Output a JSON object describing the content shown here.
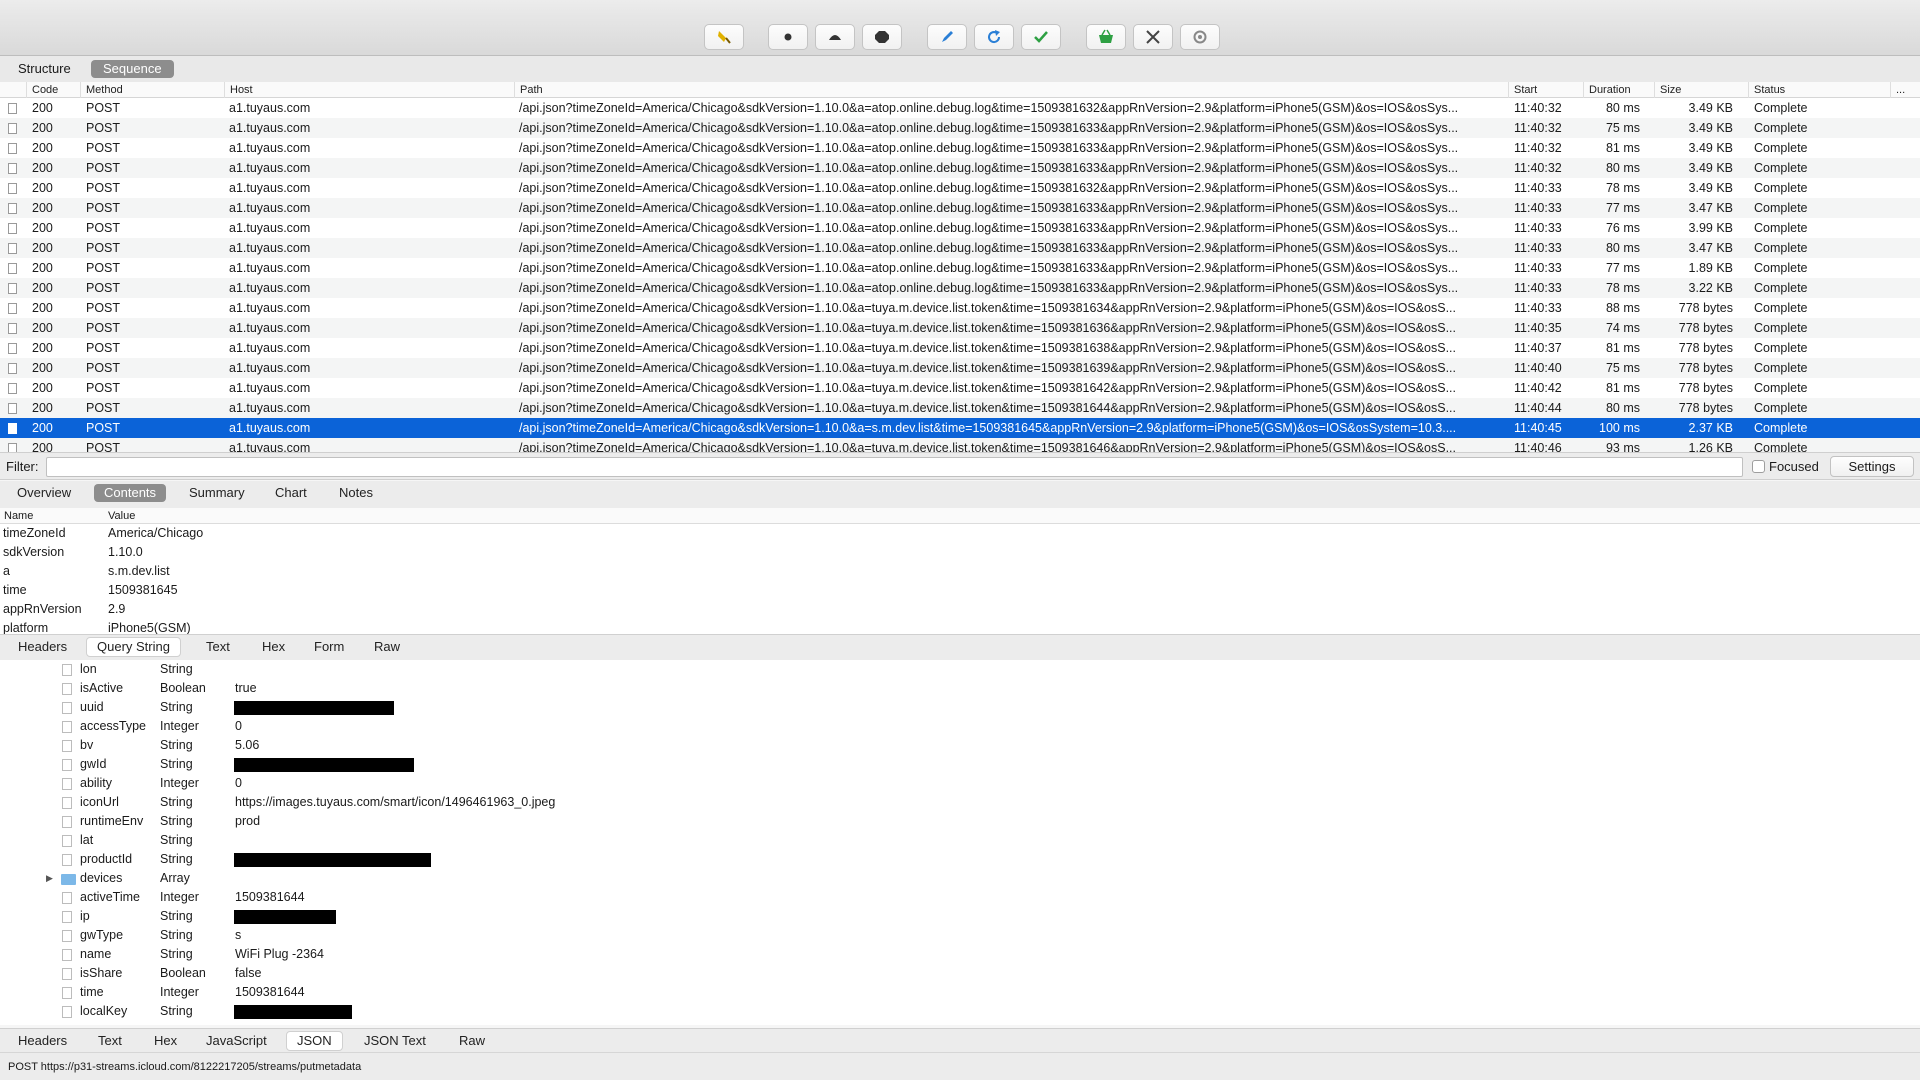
{
  "toolbar": {
    "buttons": [
      "broom-icon",
      "record-icon",
      "turtle-icon",
      "breakpoint-icon",
      "pen-icon",
      "refresh-icon",
      "check-icon",
      "basket-icon",
      "tools-icon",
      "settings-gear-icon"
    ],
    "colors": {
      "yellow": "#e0b100",
      "blue": "#2a7fd6",
      "green": "#2ea043",
      "gray": "#555555"
    }
  },
  "view_tabs": {
    "structure": "Structure",
    "sequence": "Sequence"
  },
  "sequence_table": {
    "columns": {
      "code": "Code",
      "method": "Method",
      "host": "Host",
      "path": "Path",
      "start": "Start",
      "duration": "Duration",
      "size": "Size",
      "status": "Status",
      "more": "..."
    },
    "rows": [
      {
        "code": "200",
        "method": "POST",
        "host": "a1.tuyaus.com",
        "path": "/api.json?timeZoneId=America/Chicago&sdkVersion=1.10.0&a=atop.online.debug.log&time=1509381632&appRnVersion=2.9&platform=iPhone5(GSM)&os=IOS&osSys...",
        "start": "11:40:32",
        "duration": "80 ms",
        "size": "3.49 KB",
        "status": "Complete"
      },
      {
        "code": "200",
        "method": "POST",
        "host": "a1.tuyaus.com",
        "path": "/api.json?timeZoneId=America/Chicago&sdkVersion=1.10.0&a=atop.online.debug.log&time=1509381633&appRnVersion=2.9&platform=iPhone5(GSM)&os=IOS&osSys...",
        "start": "11:40:32",
        "duration": "75 ms",
        "size": "3.49 KB",
        "status": "Complete"
      },
      {
        "code": "200",
        "method": "POST",
        "host": "a1.tuyaus.com",
        "path": "/api.json?timeZoneId=America/Chicago&sdkVersion=1.10.0&a=atop.online.debug.log&time=1509381633&appRnVersion=2.9&platform=iPhone5(GSM)&os=IOS&osSys...",
        "start": "11:40:32",
        "duration": "81 ms",
        "size": "3.49 KB",
        "status": "Complete"
      },
      {
        "code": "200",
        "method": "POST",
        "host": "a1.tuyaus.com",
        "path": "/api.json?timeZoneId=America/Chicago&sdkVersion=1.10.0&a=atop.online.debug.log&time=1509381633&appRnVersion=2.9&platform=iPhone5(GSM)&os=IOS&osSys...",
        "start": "11:40:32",
        "duration": "80 ms",
        "size": "3.49 KB",
        "status": "Complete"
      },
      {
        "code": "200",
        "method": "POST",
        "host": "a1.tuyaus.com",
        "path": "/api.json?timeZoneId=America/Chicago&sdkVersion=1.10.0&a=atop.online.debug.log&time=1509381632&appRnVersion=2.9&platform=iPhone5(GSM)&os=IOS&osSys...",
        "start": "11:40:33",
        "duration": "78 ms",
        "size": "3.49 KB",
        "status": "Complete"
      },
      {
        "code": "200",
        "method": "POST",
        "host": "a1.tuyaus.com",
        "path": "/api.json?timeZoneId=America/Chicago&sdkVersion=1.10.0&a=atop.online.debug.log&time=1509381633&appRnVersion=2.9&platform=iPhone5(GSM)&os=IOS&osSys...",
        "start": "11:40:33",
        "duration": "77 ms",
        "size": "3.47 KB",
        "status": "Complete"
      },
      {
        "code": "200",
        "method": "POST",
        "host": "a1.tuyaus.com",
        "path": "/api.json?timeZoneId=America/Chicago&sdkVersion=1.10.0&a=atop.online.debug.log&time=1509381633&appRnVersion=2.9&platform=iPhone5(GSM)&os=IOS&osSys...",
        "start": "11:40:33",
        "duration": "76 ms",
        "size": "3.99 KB",
        "status": "Complete"
      },
      {
        "code": "200",
        "method": "POST",
        "host": "a1.tuyaus.com",
        "path": "/api.json?timeZoneId=America/Chicago&sdkVersion=1.10.0&a=atop.online.debug.log&time=1509381633&appRnVersion=2.9&platform=iPhone5(GSM)&os=IOS&osSys...",
        "start": "11:40:33",
        "duration": "80 ms",
        "size": "3.47 KB",
        "status": "Complete"
      },
      {
        "code": "200",
        "method": "POST",
        "host": "a1.tuyaus.com",
        "path": "/api.json?timeZoneId=America/Chicago&sdkVersion=1.10.0&a=atop.online.debug.log&time=1509381633&appRnVersion=2.9&platform=iPhone5(GSM)&os=IOS&osSys...",
        "start": "11:40:33",
        "duration": "77 ms",
        "size": "1.89 KB",
        "status": "Complete"
      },
      {
        "code": "200",
        "method": "POST",
        "host": "a1.tuyaus.com",
        "path": "/api.json?timeZoneId=America/Chicago&sdkVersion=1.10.0&a=atop.online.debug.log&time=1509381633&appRnVersion=2.9&platform=iPhone5(GSM)&os=IOS&osSys...",
        "start": "11:40:33",
        "duration": "78 ms",
        "size": "3.22 KB",
        "status": "Complete"
      },
      {
        "code": "200",
        "method": "POST",
        "host": "a1.tuyaus.com",
        "path": "/api.json?timeZoneId=America/Chicago&sdkVersion=1.10.0&a=tuya.m.device.list.token&time=1509381634&appRnVersion=2.9&platform=iPhone5(GSM)&os=IOS&osS...",
        "start": "11:40:33",
        "duration": "88 ms",
        "size": "778 bytes",
        "status": "Complete"
      },
      {
        "code": "200",
        "method": "POST",
        "host": "a1.tuyaus.com",
        "path": "/api.json?timeZoneId=America/Chicago&sdkVersion=1.10.0&a=tuya.m.device.list.token&time=1509381636&appRnVersion=2.9&platform=iPhone5(GSM)&os=IOS&osS...",
        "start": "11:40:35",
        "duration": "74 ms",
        "size": "778 bytes",
        "status": "Complete"
      },
      {
        "code": "200",
        "method": "POST",
        "host": "a1.tuyaus.com",
        "path": "/api.json?timeZoneId=America/Chicago&sdkVersion=1.10.0&a=tuya.m.device.list.token&time=1509381638&appRnVersion=2.9&platform=iPhone5(GSM)&os=IOS&osS...",
        "start": "11:40:37",
        "duration": "81 ms",
        "size": "778 bytes",
        "status": "Complete"
      },
      {
        "code": "200",
        "method": "POST",
        "host": "a1.tuyaus.com",
        "path": "/api.json?timeZoneId=America/Chicago&sdkVersion=1.10.0&a=tuya.m.device.list.token&time=1509381639&appRnVersion=2.9&platform=iPhone5(GSM)&os=IOS&osS...",
        "start": "11:40:40",
        "duration": "75 ms",
        "size": "778 bytes",
        "status": "Complete"
      },
      {
        "code": "200",
        "method": "POST",
        "host": "a1.tuyaus.com",
        "path": "/api.json?timeZoneId=America/Chicago&sdkVersion=1.10.0&a=tuya.m.device.list.token&time=1509381642&appRnVersion=2.9&platform=iPhone5(GSM)&os=IOS&osS...",
        "start": "11:40:42",
        "duration": "81 ms",
        "size": "778 bytes",
        "status": "Complete"
      },
      {
        "code": "200",
        "method": "POST",
        "host": "a1.tuyaus.com",
        "path": "/api.json?timeZoneId=America/Chicago&sdkVersion=1.10.0&a=tuya.m.device.list.token&time=1509381644&appRnVersion=2.9&platform=iPhone5(GSM)&os=IOS&osS...",
        "start": "11:40:44",
        "duration": "80 ms",
        "size": "778 bytes",
        "status": "Complete"
      },
      {
        "code": "200",
        "method": "POST",
        "host": "a1.tuyaus.com",
        "path": "/api.json?timeZoneId=America/Chicago&sdkVersion=1.10.0&a=s.m.dev.list&time=1509381645&appRnVersion=2.9&platform=iPhone5(GSM)&os=IOS&osSystem=10.3....",
        "start": "11:40:45",
        "duration": "100 ms",
        "size": "2.37 KB",
        "status": "Complete",
        "selected": true
      },
      {
        "code": "200",
        "method": "POST",
        "host": "a1.tuyaus.com",
        "path": "/api.json?timeZoneId=America/Chicago&sdkVersion=1.10.0&a=tuya.m.device.list.token&time=1509381646&appRnVersion=2.9&platform=iPhone5(GSM)&os=IOS&osS...",
        "start": "11:40:46",
        "duration": "93 ms",
        "size": "1.26 KB",
        "status": "Complete"
      }
    ]
  },
  "filter": {
    "label": "Filter:",
    "value": "",
    "focused_label": "Focused",
    "settings_label": "Settings"
  },
  "detail_tabs": [
    "Overview",
    "Contents",
    "Summary",
    "Chart",
    "Notes"
  ],
  "request_params": {
    "columns": {
      "name": "Name",
      "value": "Value"
    },
    "rows": [
      {
        "name": "timeZoneId",
        "value": "America/Chicago"
      },
      {
        "name": "sdkVersion",
        "value": "1.10.0"
      },
      {
        "name": "a",
        "value": "s.m.dev.list"
      },
      {
        "name": "time",
        "value": "1509381645"
      },
      {
        "name": "appRnVersion",
        "value": "2.9"
      },
      {
        "name": "platform",
        "value": "iPhone5(GSM)"
      }
    ]
  },
  "request_tabs": [
    "Headers",
    "Query String",
    "Text",
    "Hex",
    "Form",
    "Raw"
  ],
  "json_tree": [
    {
      "key": "lon",
      "type": "String",
      "value": ""
    },
    {
      "key": "isActive",
      "type": "Boolean",
      "value": "true"
    },
    {
      "key": "uuid",
      "type": "String",
      "value": "",
      "redacted": 160
    },
    {
      "key": "accessType",
      "type": "Integer",
      "value": "0"
    },
    {
      "key": "bv",
      "type": "String",
      "value": "5.06"
    },
    {
      "key": "gwId",
      "type": "String",
      "value": "",
      "redacted": 180
    },
    {
      "key": "ability",
      "type": "Integer",
      "value": "0"
    },
    {
      "key": "iconUrl",
      "type": "String",
      "value": "https://images.tuyaus.com/smart/icon/1496461963_0.jpeg"
    },
    {
      "key": "runtimeEnv",
      "type": "String",
      "value": "prod"
    },
    {
      "key": "lat",
      "type": "String",
      "value": ""
    },
    {
      "key": "productId",
      "type": "String",
      "value": "",
      "redacted": 197
    },
    {
      "key": "devices",
      "type": "Array",
      "value": "",
      "folder": true
    },
    {
      "key": "activeTime",
      "type": "Integer",
      "value": "1509381644"
    },
    {
      "key": "ip",
      "type": "String",
      "value": "",
      "redacted": 102
    },
    {
      "key": "gwType",
      "type": "String",
      "value": "s"
    },
    {
      "key": "name",
      "type": "String",
      "value": "WiFi Plug -2364"
    },
    {
      "key": "isShare",
      "type": "Boolean",
      "value": "false"
    },
    {
      "key": "time",
      "type": "Integer",
      "value": "1509381644"
    },
    {
      "key": "localKey",
      "type": "String",
      "value": "",
      "redacted": 118
    }
  ],
  "response_tabs": [
    "Headers",
    "Text",
    "Hex",
    "JavaScript",
    "JSON",
    "JSON Text",
    "Raw"
  ],
  "status_bar": "POST https://p31-streams.icloud.com/8122217205/streams/putmetadata"
}
